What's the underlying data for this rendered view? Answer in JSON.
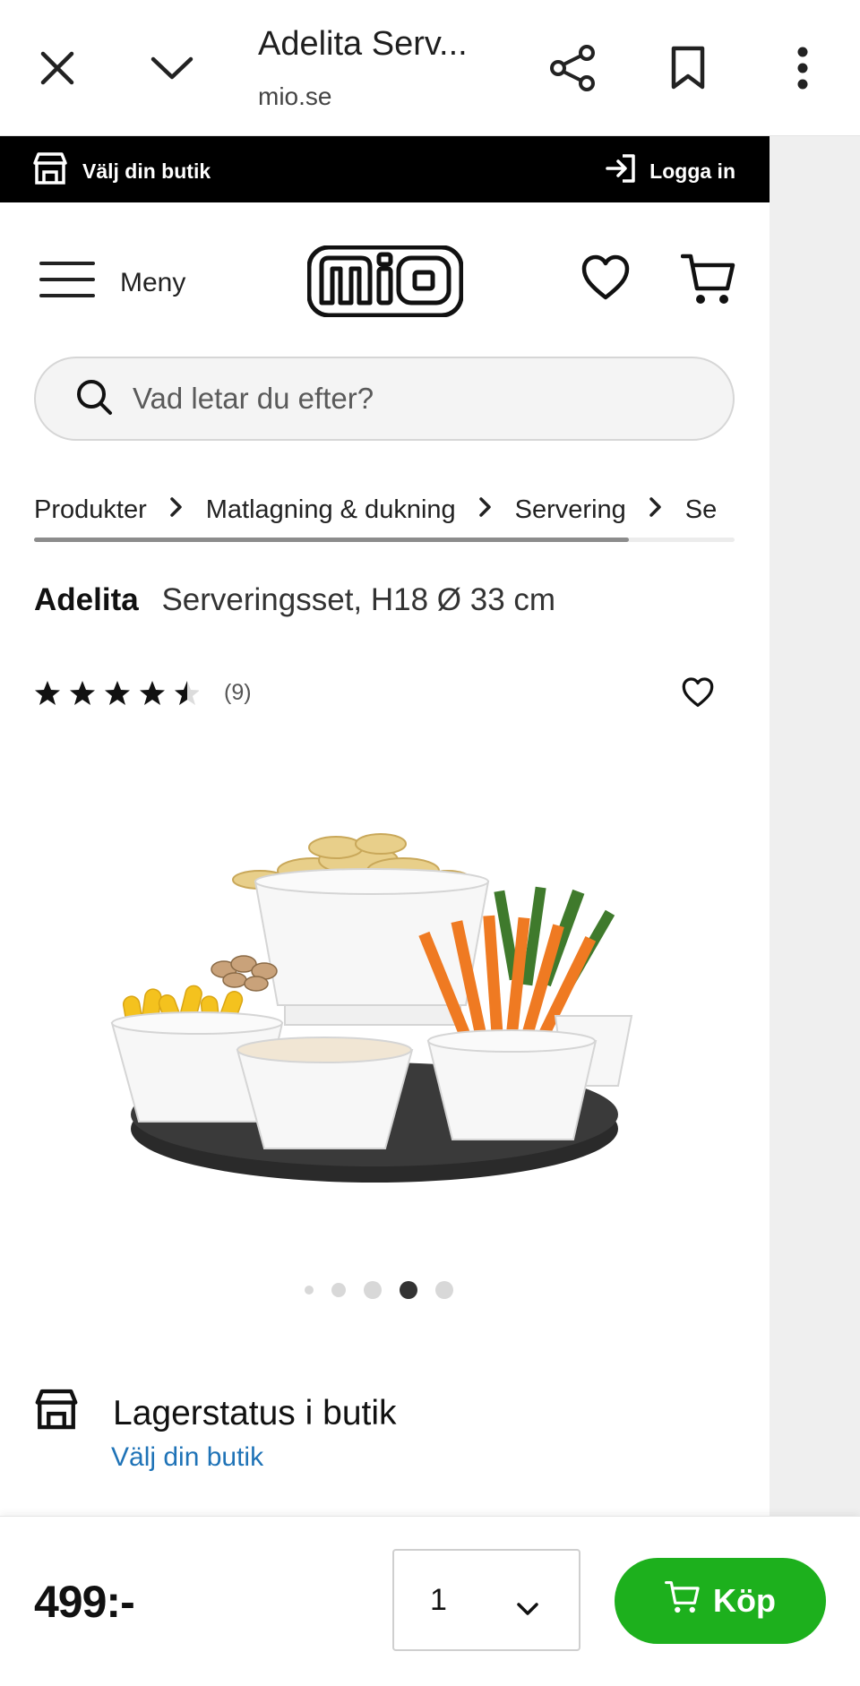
{
  "browser": {
    "page_title": "Adelita Serv...",
    "url": "mio.se",
    "icons": [
      "close-icon",
      "chevron-down-icon",
      "share-icon",
      "bookmark-icon",
      "more-vert-icon"
    ]
  },
  "top_strip": {
    "store_label": "Välj din butik",
    "login_label": "Logga in"
  },
  "header": {
    "menu_label": "Meny",
    "logo_text": "MIO"
  },
  "search": {
    "placeholder": "Vad letar du efter?"
  },
  "breadcrumbs": [
    "Produkter",
    "Matlagning & dukning",
    "Servering",
    "Se"
  ],
  "product": {
    "brand": "Adelita",
    "description": "Serveringsset, H18 Ø 33 cm",
    "rating": 4.5,
    "review_count": "(9)",
    "image_count": 5,
    "active_image_index": 3
  },
  "stock": {
    "title": "Lagerstatus i butik",
    "link": "Välj din butik"
  },
  "buy_bar": {
    "price": "499:-",
    "quantity": "1",
    "buy_label": "Köp"
  },
  "colors": {
    "buy_green": "#1db01d",
    "link_blue": "#1f73b7",
    "strip_black": "#000000"
  }
}
